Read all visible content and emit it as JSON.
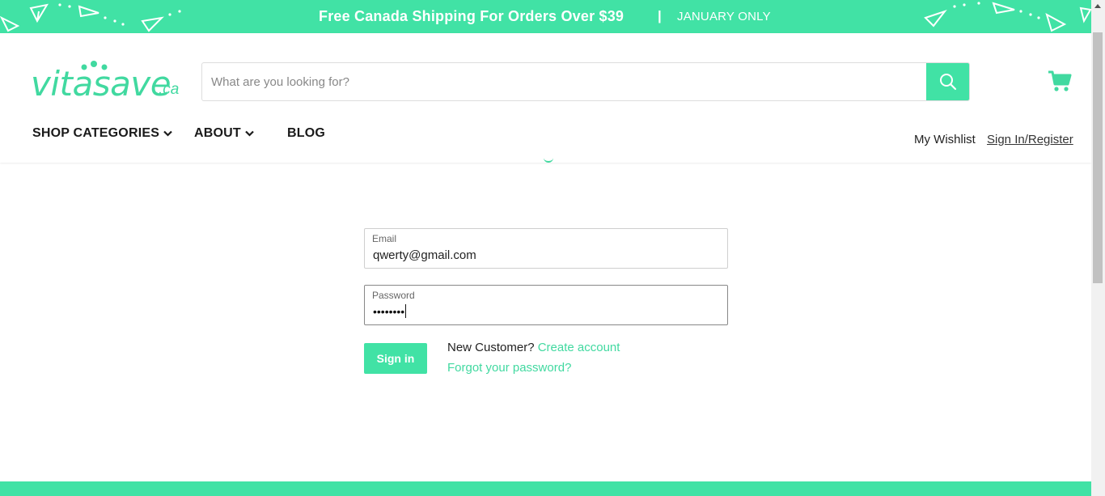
{
  "announcement": {
    "message": "Free Canada Shipping For Orders Over $39",
    "separator": "|",
    "subtext": "JANUARY ONLY"
  },
  "header": {
    "logo_word": "vitasave",
    "logo_suffix": ".ca",
    "search_placeholder": "What are you looking for?",
    "nav": [
      {
        "label": "SHOP CATEGORIES"
      },
      {
        "label": "ABOUT"
      },
      {
        "label": "BLOG"
      }
    ],
    "wishlist": "My Wishlist",
    "signin_register": "Sign In/Register"
  },
  "form": {
    "email_label": "Email",
    "email_value": "qwerty@gmail.com",
    "password_label": "Password",
    "password_masked": "••••••••",
    "signin_button": "Sign in",
    "new_customer": "New Customer?",
    "create_account": "Create account",
    "forgot_password": "Forgot your password?"
  },
  "colors": {
    "brand": "#41e2a5"
  }
}
